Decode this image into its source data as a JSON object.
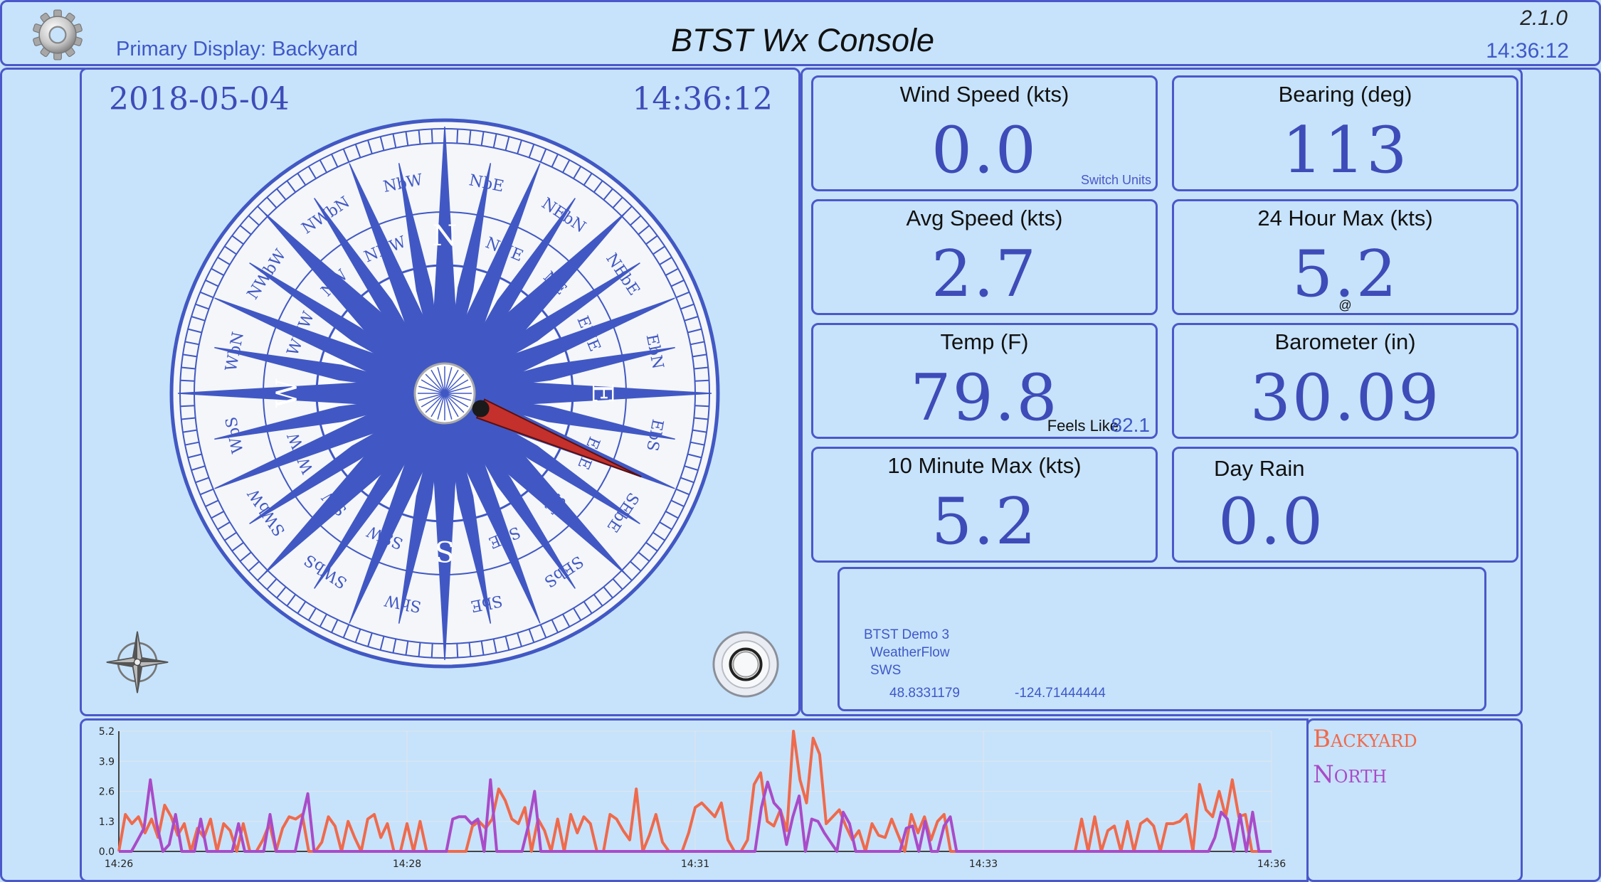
{
  "header": {
    "subtitle": "Primary Display: Backyard",
    "title": "BTST Wx Console",
    "version": "2.1.0",
    "time": "14:36:12"
  },
  "compass": {
    "date": "2018-05-04",
    "time": "14:36:12",
    "bearing_deg": 113,
    "points": [
      "N",
      "NbE",
      "NNE",
      "NEbN",
      "NE",
      "NEbE",
      "ENE",
      "EbN",
      "E",
      "EbS",
      "ESE",
      "SEbE",
      "SE",
      "SEbS",
      "SSE",
      "SbE",
      "S",
      "SbW",
      "SSW",
      "SWbS",
      "SW",
      "SWbW",
      "WSW",
      "WbS",
      "W",
      "WbN",
      "WNW",
      "NWbW",
      "NW",
      "NWbN",
      "NNW",
      "NbW"
    ]
  },
  "tiles": {
    "wind_speed": {
      "label": "Wind Speed (kts)",
      "value": "0.0",
      "link": "Switch Units"
    },
    "bearing": {
      "label": "Bearing (deg)",
      "value": "113"
    },
    "avg_speed": {
      "label": "Avg Speed (kts)",
      "value": "2.7"
    },
    "max24": {
      "label": "24 Hour Max (kts)",
      "value": "5.2",
      "note": "@"
    },
    "temp": {
      "label": "Temp (F)",
      "value": "79.8",
      "feels_label": "Feels Like",
      "feels_value": "82.1"
    },
    "barometer": {
      "label": "Barometer (in)",
      "value": "30.09"
    },
    "max10": {
      "label": "10 Minute Max (kts)",
      "value": "5.2"
    },
    "rain": {
      "label": "Day Rain",
      "value": "0.0"
    }
  },
  "station": {
    "name": "BTST Demo 3",
    "source": "WeatherFlow",
    "type": "SWS",
    "lat": "48.8331179",
    "lon": "-124.71444444"
  },
  "legend": {
    "items": [
      {
        "name": "Backyard",
        "color": "#ef6a4c"
      },
      {
        "name": "North",
        "color": "#a94bc8"
      }
    ]
  },
  "chart_data": {
    "type": "line",
    "x_tick_labels": [
      "14:26",
      "14:28",
      "14:31",
      "14:33",
      "14:36"
    ],
    "y_tick_labels": [
      "0.0",
      "1.3",
      "2.6",
      "3.9",
      "5.2"
    ],
    "ylim": [
      0,
      5.2
    ],
    "grid": true,
    "series": [
      {
        "name": "Backyard",
        "color": "#ef6a4c",
        "values": [
          0,
          1.6,
          1.2,
          1.5,
          0.8,
          1.4,
          0.6,
          2,
          1.5,
          0.7,
          1.2,
          0,
          1,
          0.6,
          1.4,
          0,
          1.2,
          0.9,
          0,
          1.2,
          0,
          0,
          0.5,
          1.2,
          0,
          1,
          1.5,
          1.4,
          1.6,
          0,
          0,
          0.4,
          1.5,
          1.1,
          0,
          1.3,
          0.6,
          0,
          1.4,
          1.6,
          0.6,
          1.2,
          0,
          0,
          1.2,
          0,
          1.3,
          0,
          0,
          0,
          0,
          0,
          0,
          0,
          1.1,
          1.3,
          1.0,
          1.4,
          2.7,
          2.2,
          1.4,
          1.2,
          1.9,
          0,
          1.4,
          0.9,
          0,
          1.4,
          0,
          1.6,
          0.8,
          1.5,
          1.2,
          0,
          0,
          1.6,
          1.4,
          0.9,
          0.5,
          2.7,
          0,
          0.7,
          1.6,
          0.4,
          0,
          0,
          0,
          0.8,
          1.9,
          2.1,
          1.8,
          1.5,
          2.1,
          0.5,
          0,
          0,
          0.5,
          2.9,
          3.4,
          1.3,
          1.1,
          1.8,
          0.9,
          5.2,
          3.1,
          2.1,
          4.9,
          4.2,
          1.2,
          1.5,
          1.8,
          1.1,
          0.5,
          0.9,
          0,
          1.2,
          0.7,
          0.6,
          1.4,
          0.7,
          0,
          1.6,
          0.8,
          1.5,
          0.5,
          1.3,
          1.6,
          0,
          0,
          0,
          0,
          0,
          0,
          0,
          0,
          0,
          0,
          0,
          0,
          0,
          0,
          0,
          0,
          0,
          0,
          0,
          0,
          1.4,
          0,
          1.5,
          0,
          0.9,
          1.1,
          0,
          1.3,
          0,
          1.2,
          1.4,
          1.1,
          0,
          1.2,
          1.2,
          1.3,
          1.6,
          0,
          2.9,
          1.8,
          1.5,
          2.6,
          1.5,
          3.1,
          1.5,
          1.6,
          0,
          0,
          0,
          0
        ]
      },
      {
        "name": "North",
        "color": "#a94bc8",
        "values": [
          0,
          0,
          0,
          0.5,
          1.0,
          3.1,
          1.2,
          0,
          0.3,
          1.6,
          0,
          0,
          0,
          1.4,
          0,
          0,
          0,
          0,
          0,
          1.2,
          0,
          0,
          0,
          0,
          1.6,
          0,
          0,
          0,
          0,
          1.3,
          2.5,
          0,
          0,
          0,
          0,
          0,
          0,
          0,
          0,
          0,
          0,
          0,
          0,
          0,
          0,
          0,
          0,
          0,
          0,
          0,
          0,
          0,
          0,
          1.4,
          1.5,
          1.5,
          1.2,
          1.4,
          0,
          3.1,
          0,
          0,
          0,
          0,
          0,
          1.1,
          2.6,
          0,
          0,
          0,
          0,
          0,
          0,
          0,
          0,
          0,
          0,
          0,
          0,
          0,
          0,
          0,
          0,
          0,
          0,
          0,
          0,
          0,
          0,
          0,
          0,
          0,
          0,
          0,
          0,
          0,
          0,
          0,
          0,
          0,
          0,
          0,
          1.9,
          3.0,
          2.1,
          1.8,
          0.3,
          1.5,
          2.4,
          0,
          1.4,
          1.3,
          0.8,
          0.4,
          0,
          1.7,
          1.2,
          0,
          0,
          0,
          0,
          0,
          0,
          0,
          0,
          1.0,
          1.1,
          0,
          1.3,
          0,
          0,
          1.1,
          1.5,
          0,
          0,
          0,
          0,
          0,
          0,
          0,
          0,
          0,
          0,
          0,
          0,
          0,
          0,
          0,
          0,
          0,
          0,
          0,
          0,
          0,
          0,
          0,
          0,
          0,
          0,
          0,
          0,
          0,
          0,
          0,
          0,
          0,
          0,
          0,
          0,
          0,
          0,
          0,
          0,
          0,
          0.6,
          1.7,
          1.4,
          0,
          1.6,
          0,
          1.7,
          0,
          0,
          0
        ]
      }
    ]
  }
}
